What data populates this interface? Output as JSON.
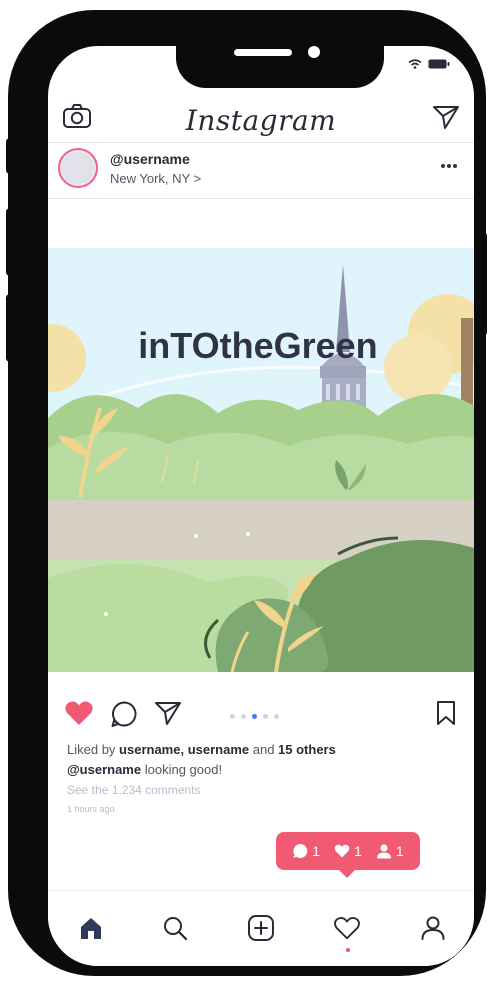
{
  "app": {
    "brand": "Instagram"
  },
  "post": {
    "username": "@username",
    "location": "New York, NY >",
    "image_title": "inTOtheGreen",
    "carousel": {
      "total": 5,
      "active": 3
    },
    "likes": {
      "prefix": "Liked by ",
      "names": "username, username",
      "middle": " and ",
      "others": "15 others"
    },
    "caption": {
      "user": "@username",
      "text": " looking good!"
    },
    "comments_link": "See the 1,234 comments",
    "time": "1 hours ago"
  },
  "notification": {
    "comments": "1",
    "likes": "1",
    "followers": "1"
  },
  "colors": {
    "accent": "#f05a72",
    "like": "#f05a72",
    "text_dark": "#2a2a38",
    "text_muted": "#b8bccb",
    "carousel_active": "#3d7cf0",
    "sky": "#dff4fb",
    "grass": "#a8d08d",
    "path": "#d7d1c5"
  },
  "icons": {
    "camera": "camera-icon",
    "send": "paper-plane-icon",
    "more": "ellipsis-icon",
    "like": "heart-filled-icon",
    "comment": "speech-bubble-icon",
    "share": "paper-plane-icon",
    "save": "bookmark-icon",
    "nav_home": "home-icon",
    "nav_search": "search-icon",
    "nav_add": "add-square-icon",
    "nav_activity": "heart-outline-icon",
    "nav_profile": "person-icon"
  }
}
